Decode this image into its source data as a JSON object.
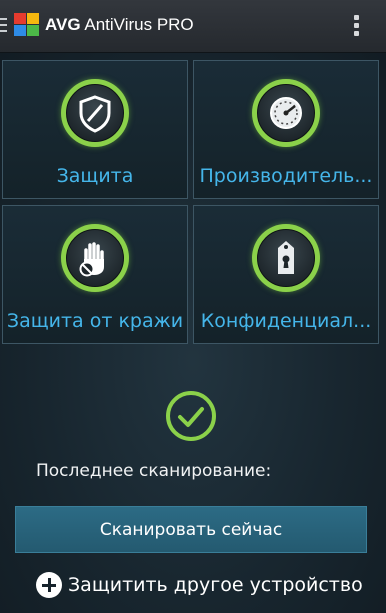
{
  "header": {
    "brand_bold": "AVG",
    "brand_rest": "AntiVirus PRO"
  },
  "tiles": [
    {
      "label": "Защита",
      "icon": "shield-icon"
    },
    {
      "label": "Производитель...",
      "icon": "speedometer-icon"
    },
    {
      "label": "Защита от кражи",
      "icon": "stop-hand-icon"
    },
    {
      "label": "Конфиденциал...",
      "icon": "tag-keyhole-icon"
    }
  ],
  "status": {
    "last_scan_label": "Последнее сканирование:",
    "icon": "check-circle-icon"
  },
  "actions": {
    "scan_button": "Сканировать сейчас",
    "protect_device": "Защитить другое устройство"
  },
  "colors": {
    "accent_green": "#8bd14a",
    "label_blue": "#45b6ea",
    "button_teal": "#2c6b85"
  }
}
